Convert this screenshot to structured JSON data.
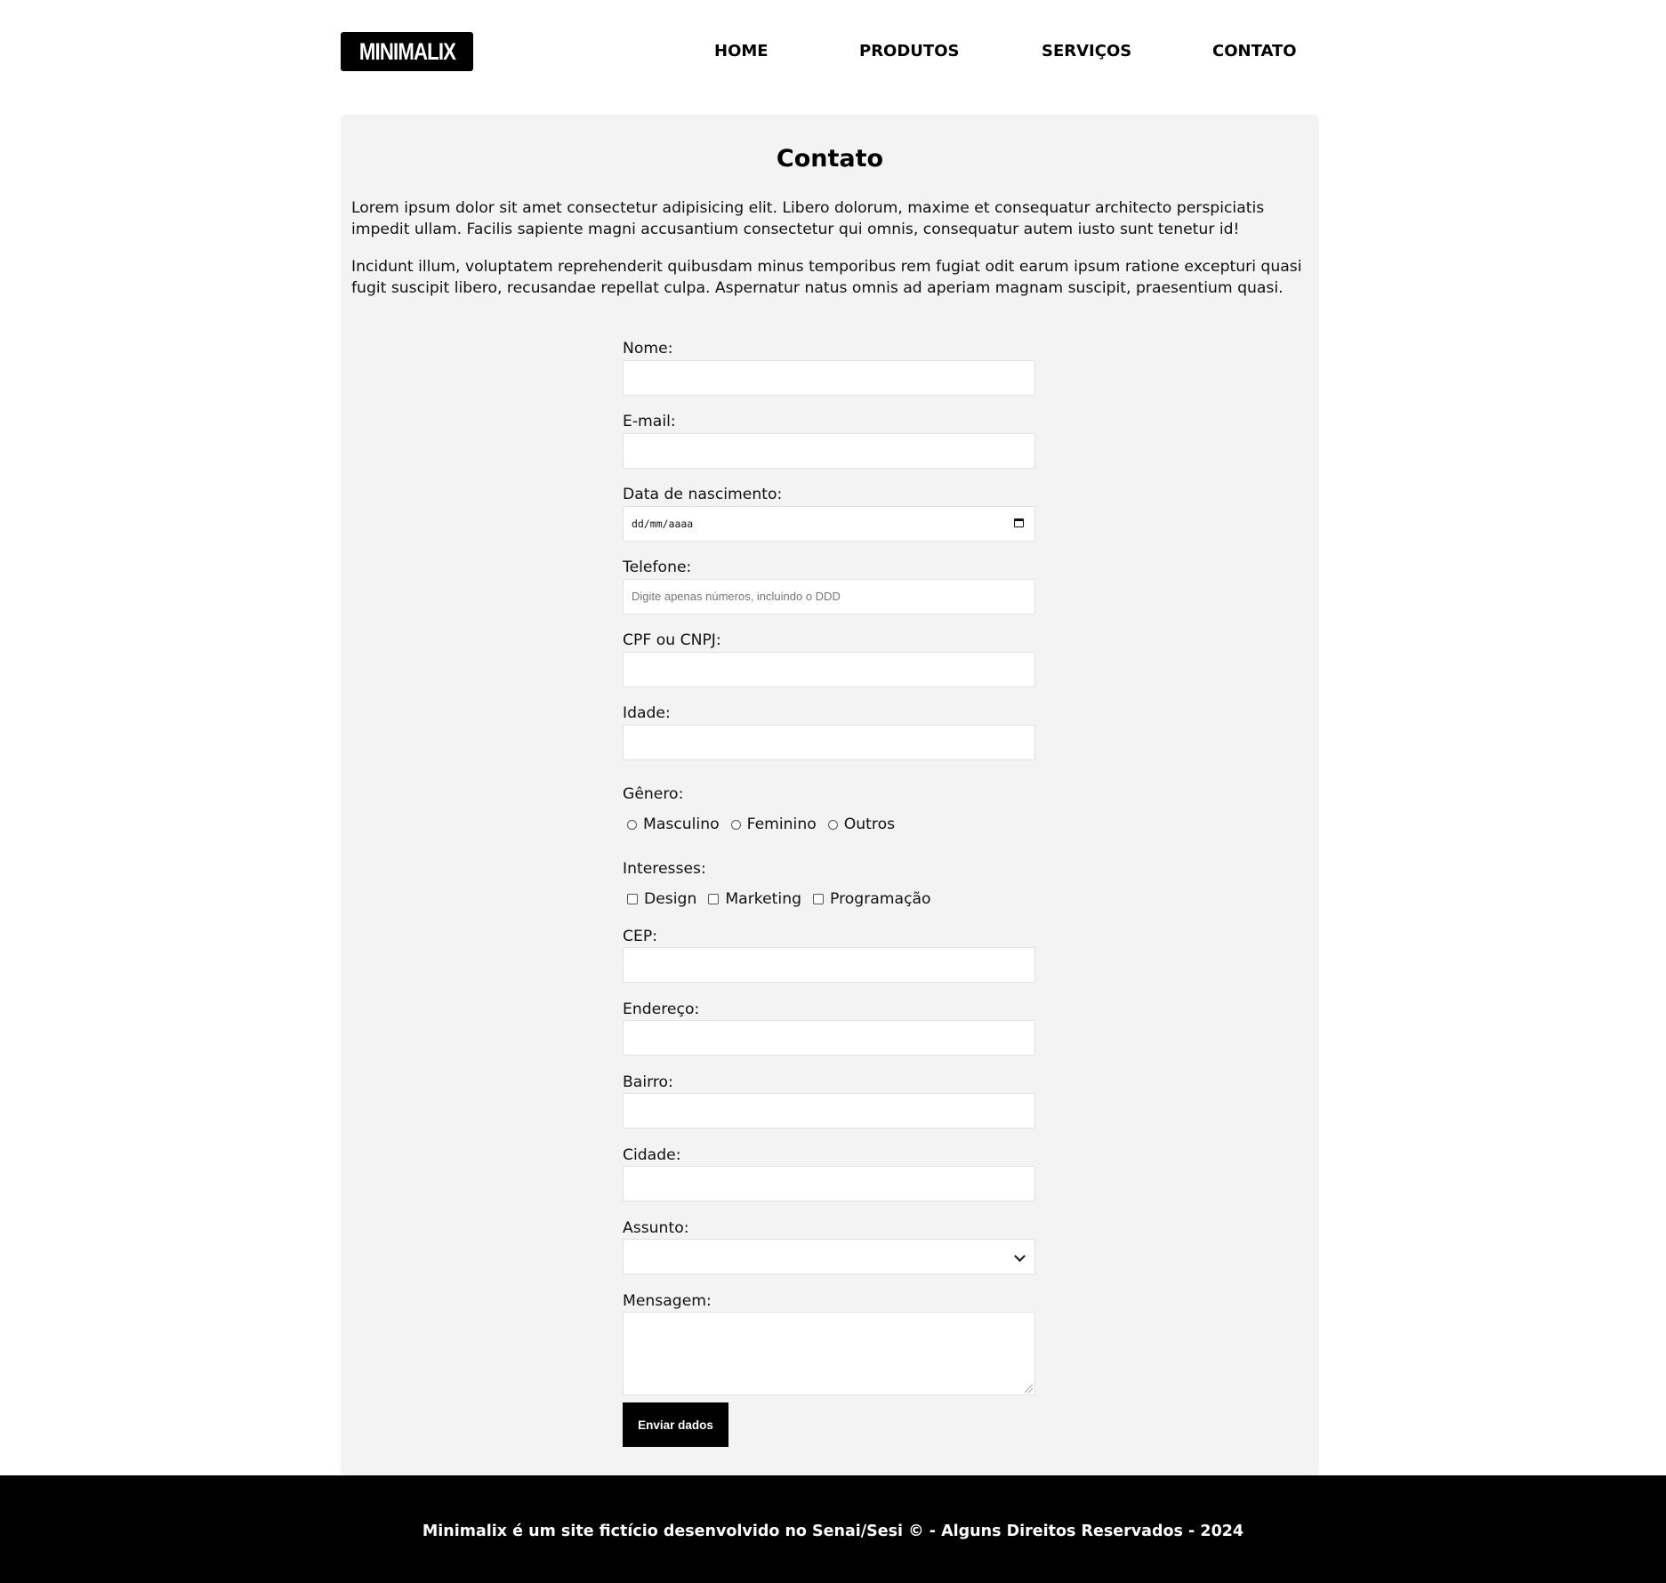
{
  "header": {
    "logo": "MINIMALIX",
    "nav": [
      "HOME",
      "PRODUTOS",
      "SERVIÇOS",
      "CONTATO"
    ]
  },
  "main": {
    "title": "Contato",
    "paragraphs": [
      "Lorem ipsum dolor sit amet consectetur adipisicing elit. Libero dolorum, maxime et consequatur architecto perspiciatis impedit ullam. Facilis sapiente magni accusantium consectetur qui omnis, consequatur autem iusto sunt tenetur id!",
      "Incidunt illum, voluptatem reprehenderit quibusdam minus temporibus rem fugiat odit earum ipsum ratione excepturi quasi fugit suscipit libero, recusandae repellat culpa. Aspernatur natus omnis ad aperiam magnam suscipit, praesentium quasi."
    ]
  },
  "form": {
    "nome_label": "Nome:",
    "email_label": "E-mail:",
    "nascimento_label": "Data de nascimento:",
    "nascimento_placeholder": "dd/mm/aaaa",
    "telefone_label": "Telefone:",
    "telefone_placeholder": "Digite apenas números, incluindo o DDD",
    "cpf_label": "CPF ou CNPJ:",
    "idade_label": "Idade:",
    "genero_label": "Gênero:",
    "genero_options": [
      "Masculino",
      "Feminino",
      "Outros"
    ],
    "interesses_label": "Interesses:",
    "interesses_options": [
      "Design",
      "Marketing",
      "Programação"
    ],
    "cep_label": "CEP:",
    "endereco_label": "Endereço:",
    "bairro_label": "Bairro:",
    "cidade_label": "Cidade:",
    "assunto_label": "Assunto:",
    "assunto_value": "",
    "mensagem_label": "Mensagem:",
    "submit_label": "Enviar dados"
  },
  "footer": {
    "text": "Minimalix é um site fictício desenvolvido no Senai/Sesi © - Alguns Direitos Reservados - 2024"
  }
}
